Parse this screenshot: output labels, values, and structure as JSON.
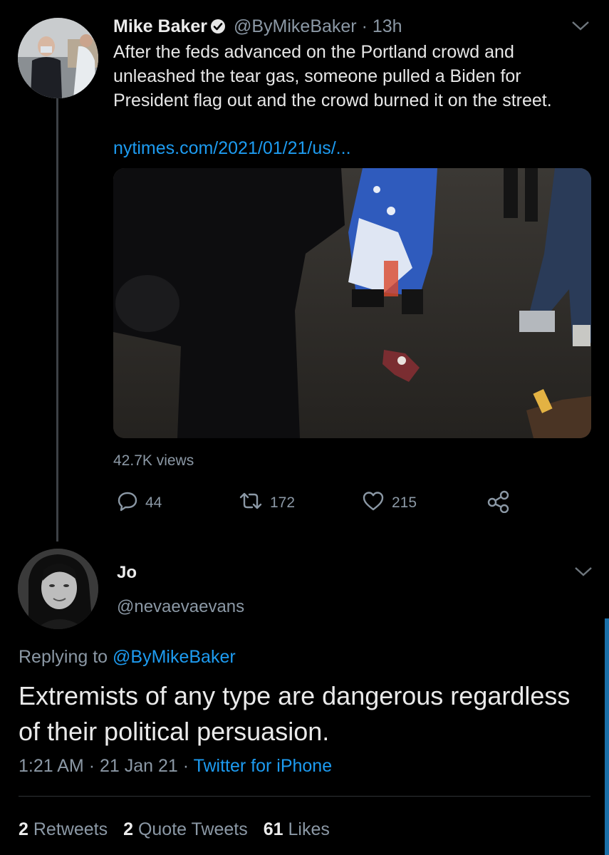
{
  "parent_tweet": {
    "display_name": "Mike Baker",
    "handle": "@ByMikeBaker",
    "separator": "·",
    "time": "13h",
    "text": "After the feds advanced on the Portland crowd and unleashed the tear gas, someone pulled a Biden for President flag out and the crowd burned it on the street.",
    "link": "nytimes.com/2021/01/21/us/...",
    "views": "42.7K views",
    "replies": "44",
    "retweets": "172",
    "likes": "215",
    "icons": [
      "verified-icon",
      "chevron-down-icon",
      "reply-icon",
      "retweet-icon",
      "like-icon",
      "share-icon"
    ]
  },
  "reply_tweet": {
    "display_name": "Jo",
    "handle": "@nevaevaevans",
    "replying_prefix": "Replying to",
    "replying_to": "@ByMikeBaker",
    "text": "Extremists of any type are dangerous regardless of their political persuasion.",
    "time": "1:21 AM",
    "separator": "·",
    "date": "21 Jan 21",
    "source": "Twitter for iPhone",
    "retweets_count": "2",
    "retweets_label": "Retweets",
    "quote_count": "2",
    "quote_label": "Quote Tweets",
    "likes_count": "61",
    "likes_label": "Likes"
  },
  "colors": {
    "background": "#000000",
    "link": "#1d9bf0",
    "muted": "#8b98a5"
  }
}
